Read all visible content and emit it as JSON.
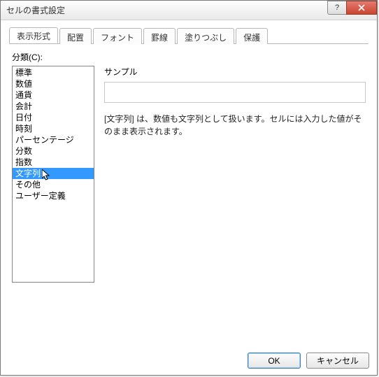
{
  "window": {
    "title": "セルの書式設定"
  },
  "tabs": {
    "display_format": "表示形式",
    "alignment": "配置",
    "font": "フォント",
    "border": "罫線",
    "fill": "塗りつぶし",
    "protection": "保護"
  },
  "panel": {
    "category_label": "分類(C):",
    "sample_label": "サンプル",
    "description": "[文字列] は、数値も文字列として扱います。セルには入力した値がそのまま表示されます。"
  },
  "categories": [
    "標準",
    "数値",
    "通貨",
    "会計",
    "日付",
    "時刻",
    "パーセンテージ",
    "分数",
    "指数",
    "文字列",
    "その他",
    "ユーザー定義"
  ],
  "selected_category_index": 9,
  "buttons": {
    "ok": "OK",
    "cancel": "キャンセル"
  }
}
